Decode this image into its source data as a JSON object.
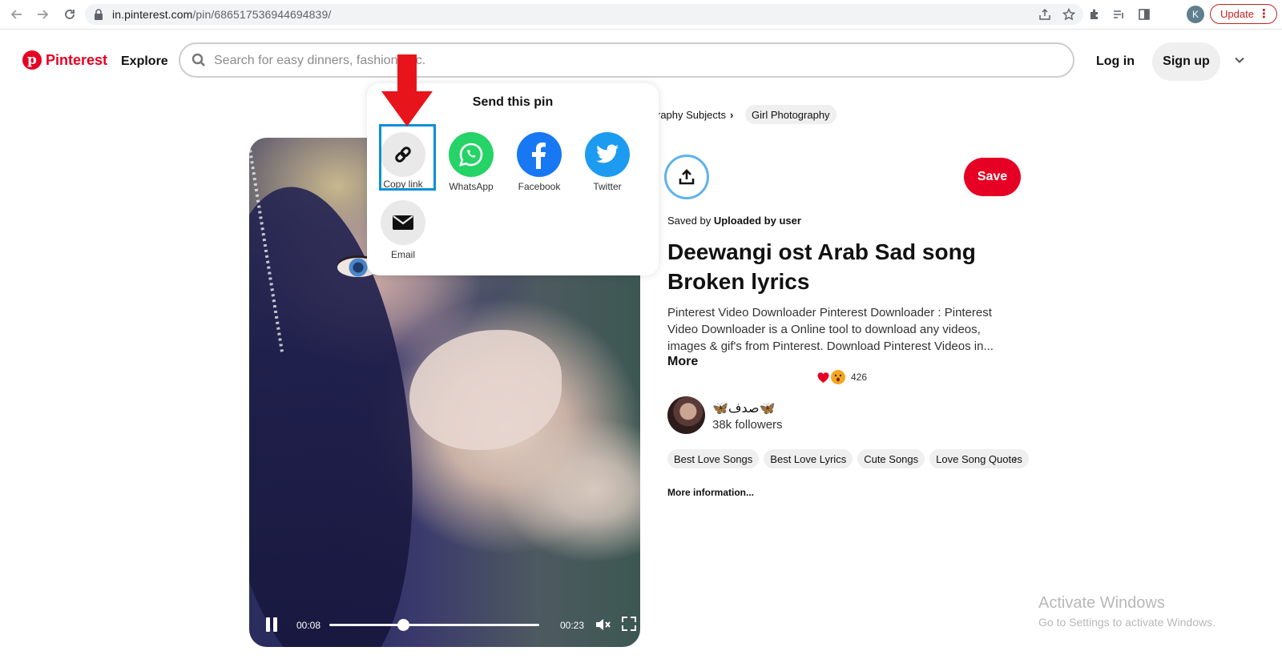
{
  "browser": {
    "url_host": "in.pinterest.com",
    "url_path": "/pin/686517536944694839/",
    "profile_initial": "K",
    "update_label": "Update"
  },
  "header": {
    "logo_text": "Pinterest",
    "explore_label": "Explore",
    "search_placeholder": "Search for easy dinners, fashion, etc.",
    "login_label": "Log in",
    "signup_label": "Sign up"
  },
  "breadcrumbs": {
    "partial_item": "raphy Subjects",
    "current_item": "Girl Photography"
  },
  "share": {
    "title": "Send this pin",
    "options": [
      {
        "label": "Copy link",
        "color": "#e9e9e9"
      },
      {
        "label": "WhatsApp",
        "color": "#25d366"
      },
      {
        "label": "Facebook",
        "color": "#1877f2"
      },
      {
        "label": "Twitter",
        "color": "#1d9bf0"
      },
      {
        "label": "Email",
        "color": "#e9e9e9"
      }
    ]
  },
  "video": {
    "current_time": "00:08",
    "duration": "00:23",
    "progress": 0.35
  },
  "pin": {
    "save_label": "Save",
    "saved_by_prefix": "Saved by",
    "saved_by_user": "Uploaded by user",
    "title": "Deewangi ost Arab Sad song Broken lyrics",
    "description": "Pinterest Video Downloader Pinterest Downloader : Pinterest Video Downloader is a Online tool to download any videos, images & gif's from Pinterest. Download Pinterest Videos in...",
    "more_label": "More",
    "reaction_count": "426",
    "creator_name": "🦋صدف🦋",
    "followers": "38k followers",
    "tags": [
      "Best Love Songs",
      "Best Love Lyrics",
      "Cute Songs",
      "Love Song Quotes"
    ],
    "more_info_label": "More information..."
  },
  "watermark": {
    "line1": "Activate Windows",
    "line2": "Go to Settings to activate Windows."
  },
  "colors": {
    "brand": "#e60023",
    "highlight": "#0b8fd8",
    "annotation_arrow": "#e8141c"
  }
}
